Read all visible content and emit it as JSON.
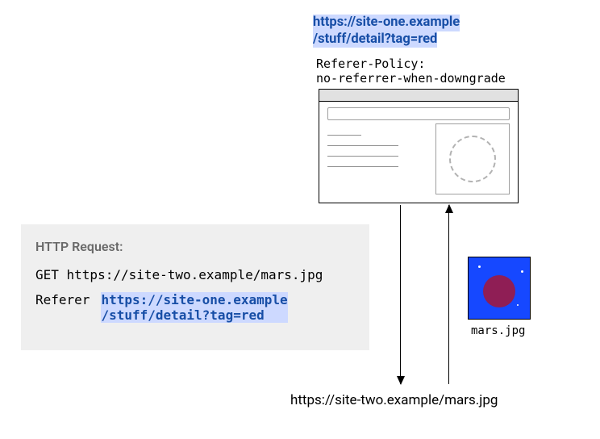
{
  "source_url": {
    "line1": "https://site-one.example",
    "line2": "/stuff/detail?tag=red"
  },
  "policy": {
    "header": "Referer-Policy:",
    "value": "no-referrer-when-downgrade"
  },
  "destination_url": "https://site-two.example/mars.jpg",
  "image_caption": "mars.jpg",
  "request": {
    "title": "HTTP Request:",
    "method_line": "GET https://site-two.example/mars.jpg",
    "referer_label": "Referer",
    "referer_value": {
      "line1": "https://site-one.example",
      "line2": "/stuff/detail?tag=red"
    }
  }
}
